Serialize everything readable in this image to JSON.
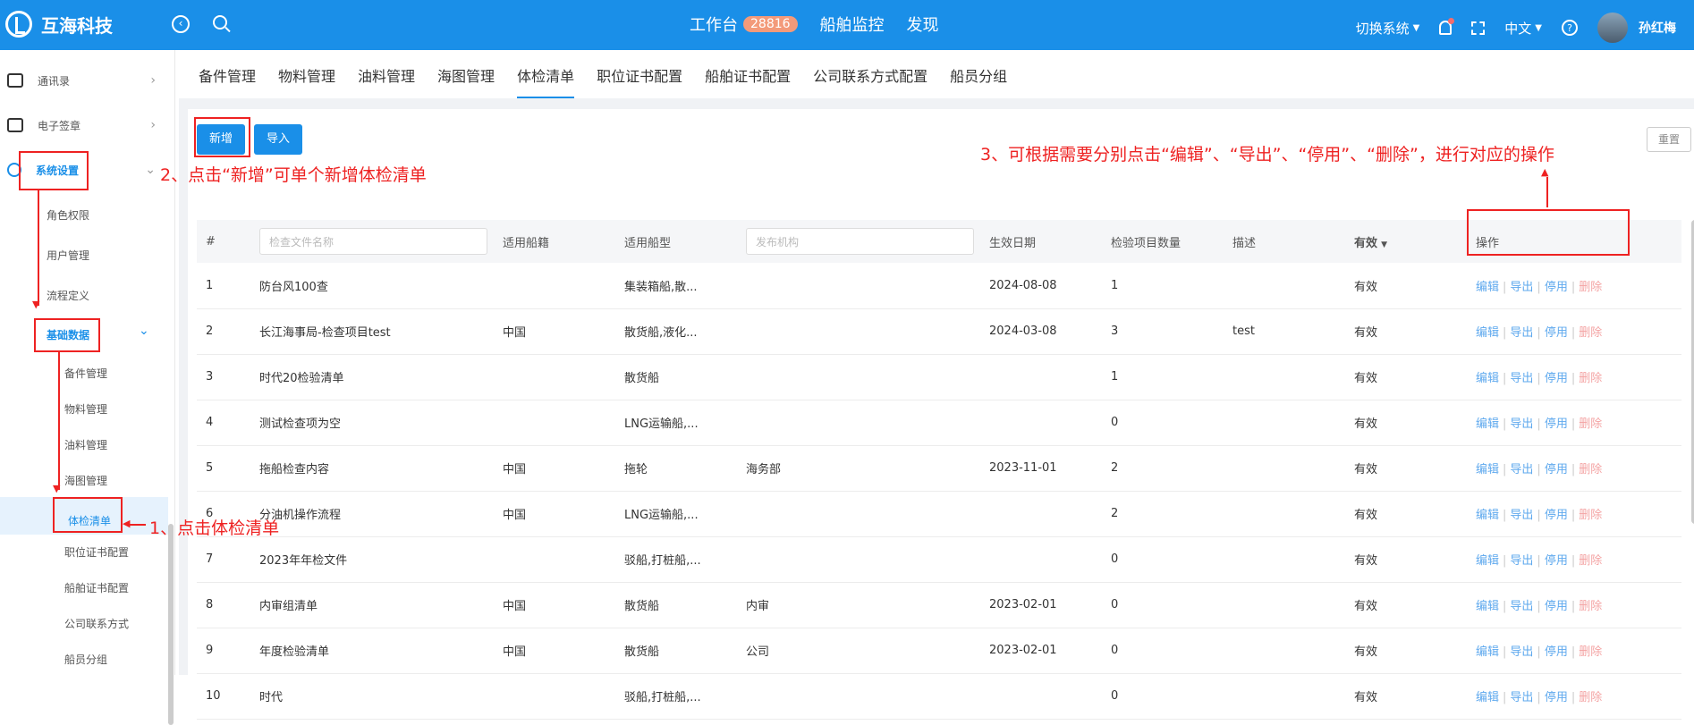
{
  "header": {
    "brand": "互海科技",
    "nav": [
      "工作台",
      "船舶监控",
      "发现"
    ],
    "badge": "28816",
    "switch_system": "切换系统",
    "language": "中文",
    "user_name": "孙红梅"
  },
  "sidebar": {
    "items": [
      {
        "label": "通讯录"
      },
      {
        "label": "电子签章"
      },
      {
        "label": "系统设置"
      }
    ],
    "system_subs": [
      "角色权限",
      "用户管理",
      "流程定义"
    ],
    "basic_data": "基础数据",
    "basic_subs": [
      "备件管理",
      "物料管理",
      "油料管理",
      "海图管理",
      "体检清单",
      "职位证书配置",
      "船舶证书配置",
      "公司联系方式",
      "船员分组"
    ]
  },
  "tabs": [
    "备件管理",
    "物料管理",
    "油料管理",
    "海图管理",
    "体检清单",
    "职位证书配置",
    "船舶证书配置",
    "公司联系方式配置",
    "船员分组"
  ],
  "toolbar": {
    "new_label": "新增",
    "import_label": "导入",
    "reset_label": "重置"
  },
  "table": {
    "headers": {
      "index": "#",
      "name_placeholder": "检查文件名称",
      "flag": "适用船籍",
      "ship_type": "适用船型",
      "org_placeholder": "发布机构",
      "date": "生效日期",
      "count": "检验项目数量",
      "desc": "描述",
      "valid": "有效",
      "ops": "操作"
    },
    "rows": [
      {
        "i": "1",
        "name": "防台风100查",
        "flag": "",
        "type": "集装箱船,散...",
        "org": "",
        "date": "2024-08-08",
        "count": "1",
        "desc": "",
        "valid": "有效"
      },
      {
        "i": "2",
        "name": "长江海事局-检查项目test",
        "flag": "中国",
        "type": "散货船,液化...",
        "org": "",
        "date": "2024-03-08",
        "count": "3",
        "desc": "test",
        "valid": "有效"
      },
      {
        "i": "3",
        "name": "时代20检验清单",
        "flag": "",
        "type": "散货船",
        "org": "",
        "date": "",
        "count": "1",
        "desc": "",
        "valid": "有效"
      },
      {
        "i": "4",
        "name": "测试检查项为空",
        "flag": "",
        "type": "LNG运输船,...",
        "org": "",
        "date": "",
        "count": "0",
        "desc": "",
        "valid": "有效"
      },
      {
        "i": "5",
        "name": "拖船检查内容",
        "flag": "中国",
        "type": "拖轮",
        "org": "海务部",
        "date": "2023-11-01",
        "count": "2",
        "desc": "",
        "valid": "有效"
      },
      {
        "i": "6",
        "name": "分油机操作流程",
        "flag": "中国",
        "type": "LNG运输船,...",
        "org": "",
        "date": "",
        "count": "2",
        "desc": "",
        "valid": "有效"
      },
      {
        "i": "7",
        "name": "2023年年检文件",
        "flag": "",
        "type": "驳船,打桩船,...",
        "org": "",
        "date": "",
        "count": "0",
        "desc": "",
        "valid": "有效"
      },
      {
        "i": "8",
        "name": "内审组清单",
        "flag": "中国",
        "type": "散货船",
        "org": "内审",
        "date": "2023-02-01",
        "count": "0",
        "desc": "",
        "valid": "有效"
      },
      {
        "i": "9",
        "name": "年度检验清单",
        "flag": "中国",
        "type": "散货船",
        "org": "公司",
        "date": "2023-02-01",
        "count": "0",
        "desc": "",
        "valid": "有效"
      },
      {
        "i": "10",
        "name": "时代",
        "flag": "",
        "type": "驳船,打桩船,...",
        "org": "",
        "date": "",
        "count": "0",
        "desc": "",
        "valid": "有效"
      }
    ],
    "ops": {
      "edit": "编辑",
      "export": "导出",
      "disable": "停用",
      "delete": "删除"
    }
  },
  "annotations": {
    "step1": "1、点击体检清单",
    "step2": "2、点击“新增”可单个新增体检清单",
    "step3": "3、可根据需要分别点击“编辑”、“导出”、“停用”、“删除”，进行对应的操作"
  },
  "colors": {
    "primary": "#1a8fe8",
    "annotation": "#ee2222"
  }
}
